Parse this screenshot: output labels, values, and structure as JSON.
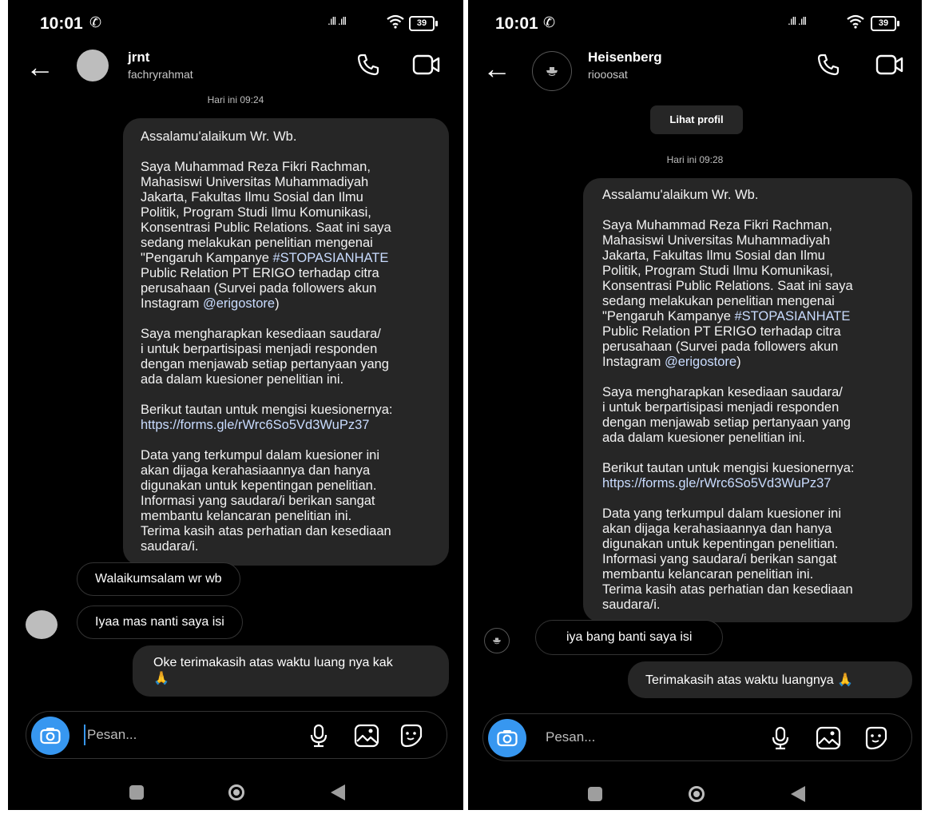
{
  "left": {
    "status": {
      "time": "10:01",
      "battery": "39"
    },
    "header": {
      "name": "jrnt",
      "username": "fachryrahmat"
    },
    "timestamp": "Hari ini 09:24",
    "message": {
      "p1": "Assalamu'alaikum Wr. Wb.",
      "p2": "Saya Muhammad Reza Fikri Rachman,\nMahasiswi Universitas Muhammadiyah\nJakarta, Fakultas Ilmu Sosial dan Ilmu\nPolitik, Program Studi Ilmu Komunikasi,\nKonsentrasi Public Relations. Saat ini saya\nsedang melakukan penelitian mengenai\n\"Pengaruh Kampanye ",
      "p2_hashtag": "#STOPASIANHATE",
      "p2_b": "\nPublic Relation PT ERIGO terhadap citra\nperusahaan (Survei pada followers akun\nInstagram ",
      "p2_mention": "@erigostore",
      "p2_c": ")",
      "p3": "Saya mengharapkan kesediaan saudara/\ni untuk berpartisipasi menjadi responden\ndengan menjawab setiap pertanyaan yang\nada dalam kuesioner penelitian ini.",
      "p4": "Berikut tautan untuk mengisi kuesionernya:",
      "p4_link": "https://forms.gle/rWrc6So5Vd3WuPz37",
      "p5": "Data yang terkumpul dalam kuesioner ini\nakan dijaga kerahasiaannya dan hanya\ndigunakan untuk kepentingan penelitian.\nInformasi yang saudara/i berikan sangat\nmembantu kelancaran penelitian ini.\nTerima kasih atas perhatian dan kesediaan\nsaudara/i."
    },
    "reply1": "Walaikumsalam wr wb",
    "reply2": "Iyaa mas nanti saya isi",
    "sent": "Oke terimakasih atas waktu luang nya kak\n🙏",
    "composer_placeholder": "Pesan..."
  },
  "right": {
    "status": {
      "time": "10:01",
      "battery": "39"
    },
    "header": {
      "name": "Heisenberg",
      "username": "riooosat"
    },
    "view_profile": "Lihat profil",
    "timestamp": "Hari ini 09:28",
    "message": {
      "p1": "Assalamu'alaikum Wr. Wb.",
      "p2": "Saya Muhammad Reza Fikri Rachman,\nMahasiswi Universitas Muhammadiyah\nJakarta, Fakultas Ilmu Sosial dan Ilmu\nPolitik, Program Studi Ilmu Komunikasi,\nKonsentrasi Public Relations. Saat ini saya\nsedang melakukan penelitian mengenai\n\"Pengaruh Kampanye ",
      "p2_hashtag": "#STOPASIANHATE",
      "p2_b": "\nPublic Relation PT ERIGO terhadap citra\nperusahaan (Survei pada followers akun\nInstagram ",
      "p2_mention": "@erigostore",
      "p2_c": ")",
      "p3": "Saya mengharapkan kesediaan saudara/\ni untuk berpartisipasi menjadi responden\ndengan menjawab setiap pertanyaan yang\nada dalam kuesioner penelitian ini.",
      "p4": "Berikut tautan untuk mengisi kuesionernya:",
      "p4_link": "https://forms.gle/rWrc6So5Vd3WuPz37",
      "p5": "Data yang terkumpul dalam kuesioner ini\nakan dijaga kerahasiaannya dan hanya\ndigunakan untuk kepentingan penelitian.\nInformasi yang saudara/i berikan sangat\nmembantu kelancaran penelitian ini.\nTerima kasih atas perhatian dan kesediaan\nsaudara/i."
    },
    "reply1": "iya bang banti saya isi",
    "sent": "Terimakasih atas waktu luangnya 🙏",
    "composer_placeholder": "Pesan..."
  },
  "icons": [
    "back-arrow-icon",
    "phone-icon",
    "video-icon",
    "camera-icon",
    "microphone-icon",
    "gallery-icon",
    "sticker-icon",
    "wifi-icon",
    "signal-icon",
    "battery-icon"
  ],
  "colors": {
    "background": "#000000",
    "bubble": "#262626",
    "link": "#c9dcff",
    "accent": "#3797f0"
  }
}
